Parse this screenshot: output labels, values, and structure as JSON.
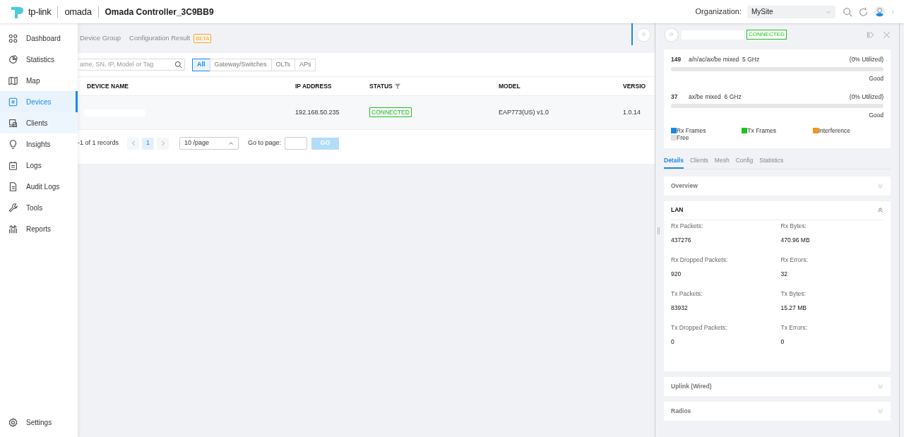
{
  "header": {
    "brand": "tp-link",
    "product": "omada",
    "controller": "Omada Controller_3C9BB9",
    "organization_label": "Organization:",
    "organization": "MySite"
  },
  "sidebar": {
    "items": [
      {
        "label": "Dashboard",
        "selected": false,
        "hovered": false
      },
      {
        "label": "Statistics",
        "selected": false,
        "hovered": false
      },
      {
        "label": "Map",
        "selected": false,
        "hovered": false
      },
      {
        "label": "Devices",
        "selected": true,
        "hovered": false
      },
      {
        "label": "Clients",
        "selected": false,
        "hovered": true
      },
      {
        "label": "Insights",
        "selected": false,
        "hovered": false
      },
      {
        "label": "Logs",
        "selected": false,
        "hovered": false
      },
      {
        "label": "Audit Logs",
        "selected": false,
        "hovered": false
      },
      {
        "label": "Tools",
        "selected": false,
        "hovered": false
      },
      {
        "label": "Reports",
        "selected": false,
        "hovered": false
      }
    ],
    "bottom": {
      "label": "Settings"
    }
  },
  "subtabs": [
    {
      "label": "Device Group"
    },
    {
      "label": "Configuration Result",
      "badge": "BETA"
    }
  ],
  "filter": {
    "search_placeholder": "ame, SN, IP, Model or Tag",
    "types": [
      {
        "label": "All",
        "selected": true
      },
      {
        "label": "Gateway/Switches",
        "selected": false
      },
      {
        "label": "OLTs",
        "selected": false
      },
      {
        "label": "APs",
        "selected": false
      }
    ]
  },
  "table": {
    "columns": [
      "DEVICE NAME",
      "IP ADDRESS",
      "STATUS",
      "MODEL",
      "VERSIO"
    ],
    "rows": [
      {
        "ip": "192.168.50.235",
        "status": "CONNECTED",
        "model": "EAP773(US) v1.0",
        "version": "1.0.14"
      }
    ]
  },
  "pagination": {
    "records": "-1 of 1 records",
    "page": "1",
    "page_size": "10 /page",
    "goto_label": "Go to page:",
    "go": "GO"
  },
  "panel": {
    "status": "CONNECTED",
    "channels": [
      {
        "channel": "149",
        "mode": "a/n/ac/ax/be mixed  5 GHz",
        "utilized": "(0% Utilized)",
        "level": 0,
        "quality": "Good"
      },
      {
        "channel": "37",
        "mode": "ax/be mixed  6 GHz",
        "utilized": "(0% Utilized)",
        "level": 0,
        "quality": "Good"
      }
    ],
    "legend": [
      {
        "label": "Rx Frames",
        "color": "#1e88e5"
      },
      {
        "label": "Tx Frames",
        "color": "#1fc11f"
      },
      {
        "label": "Interference",
        "color": "#f7931e"
      },
      {
        "label": "Free",
        "color": "#e0e0e0"
      }
    ],
    "tabs": [
      {
        "label": "Details",
        "selected": true
      },
      {
        "label": "Clients",
        "selected": false
      },
      {
        "label": "Mesh",
        "selected": false
      },
      {
        "label": "Config",
        "selected": false
      },
      {
        "label": "Statistics",
        "selected": false
      }
    ],
    "sections": [
      {
        "title": "Overview",
        "expanded": false
      },
      {
        "title": "LAN",
        "expanded": true,
        "fields": [
          {
            "label": "Rx Packets:",
            "value": "437276"
          },
          {
            "label": "Rx Bytes:",
            "value": "470.96 MB"
          },
          {
            "label": "Rx Dropped Packets:",
            "value": "920"
          },
          {
            "label": "Rx Errors:",
            "value": "32"
          },
          {
            "label": "Tx Packets:",
            "value": "83932"
          },
          {
            "label": "Tx Bytes:",
            "value": "15.27 MB"
          },
          {
            "label": "Tx Dropped Packets:",
            "value": "0"
          },
          {
            "label": "Tx Errors:",
            "value": "0"
          }
        ]
      },
      {
        "title": "Uplink (Wired)",
        "expanded": false
      },
      {
        "title": "Radios",
        "expanded": false
      }
    ]
  }
}
